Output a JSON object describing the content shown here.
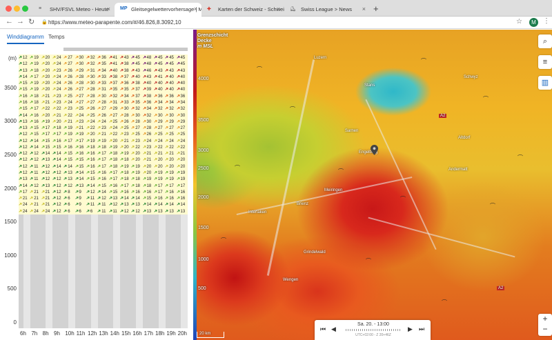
{
  "browser": {
    "tabs": [
      {
        "favicon": "≡",
        "title": "SHV/FSVL Meteo - Heute",
        "active": false
      },
      {
        "favicon": "MP",
        "title": "Gleitsegelwettervorhersage | M",
        "active": true
      },
      {
        "favicon": "✚",
        "title": "Karten der Schweiz - Schweiz",
        "active": false
      },
      {
        "favicon": "⛸",
        "title": "Swiss League > News",
        "active": false
      }
    ],
    "url": "https://www.meteo-parapente.com/#/46.826,8.3092,10",
    "avatar_letter": "M"
  },
  "left_panel": {
    "tabs": [
      "Winddiagramm",
      "Temps"
    ],
    "unit_label": "(m)",
    "y_ticks": [
      "3500",
      "3000",
      "2500",
      "2000",
      "1500",
      "1000",
      "500",
      "0"
    ],
    "hours": [
      "6h",
      "7h",
      "8h",
      "9h",
      "10h",
      "11h",
      "12h",
      "13h",
      "14h",
      "15h",
      "16h",
      "17h",
      "18h",
      "19h",
      "20h"
    ],
    "wind_rows": [
      [
        "12",
        "19",
        "20",
        "24",
        "27",
        "30",
        "32",
        "36",
        "41",
        "43",
        "45",
        "48",
        "45",
        "45",
        "45"
      ],
      [
        "12",
        "19",
        "20",
        "24",
        "27",
        "30",
        "32",
        "35",
        "41",
        "38",
        "45",
        "48",
        "45",
        "45",
        "45"
      ],
      [
        "13",
        "18",
        "20",
        "23",
        "26",
        "29",
        "31",
        "34",
        "40",
        "38",
        "43",
        "46",
        "43",
        "43",
        "43"
      ],
      [
        "14",
        "17",
        "20",
        "24",
        "26",
        "28",
        "30",
        "33",
        "38",
        "37",
        "40",
        "43",
        "41",
        "40",
        "40"
      ],
      [
        "15",
        "19",
        "20",
        "24",
        "26",
        "28",
        "30",
        "33",
        "37",
        "36",
        "38",
        "40",
        "40",
        "40",
        "40"
      ],
      [
        "15",
        "19",
        "20",
        "24",
        "26",
        "27",
        "28",
        "31",
        "35",
        "35",
        "37",
        "39",
        "40",
        "40",
        "40"
      ],
      [
        "16",
        "18",
        "21",
        "23",
        "25",
        "27",
        "28",
        "30",
        "32",
        "34",
        "37",
        "38",
        "36",
        "36",
        "36"
      ],
      [
        "16",
        "18",
        "21",
        "23",
        "24",
        "27",
        "27",
        "28",
        "31",
        "33",
        "35",
        "36",
        "34",
        "34",
        "34"
      ],
      [
        "15",
        "17",
        "22",
        "22",
        "23",
        "25",
        "26",
        "27",
        "29",
        "30",
        "32",
        "34",
        "32",
        "32",
        "32"
      ],
      [
        "14",
        "16",
        "20",
        "21",
        "22",
        "24",
        "25",
        "26",
        "27",
        "28",
        "30",
        "32",
        "30",
        "30",
        "30"
      ],
      [
        "13",
        "16",
        "19",
        "20",
        "21",
        "23",
        "24",
        "24",
        "25",
        "26",
        "28",
        "30",
        "29",
        "29",
        "29"
      ],
      [
        "13",
        "15",
        "17",
        "18",
        "19",
        "21",
        "22",
        "23",
        "24",
        "25",
        "27",
        "28",
        "27",
        "27",
        "27"
      ],
      [
        "12",
        "15",
        "17",
        "17",
        "19",
        "19",
        "20",
        "21",
        "22",
        "23",
        "25",
        "26",
        "25",
        "25",
        "25"
      ],
      [
        "12",
        "14",
        "15",
        "16",
        "17",
        "17",
        "19",
        "19",
        "20",
        "21",
        "23",
        "24",
        "24",
        "24",
        "24"
      ],
      [
        "12",
        "14",
        "15",
        "15",
        "16",
        "16",
        "18",
        "18",
        "19",
        "20",
        "22",
        "23",
        "22",
        "22",
        "22"
      ],
      [
        "12",
        "12",
        "14",
        "14",
        "15",
        "16",
        "16",
        "17",
        "18",
        "19",
        "20",
        "21",
        "21",
        "21",
        "21"
      ],
      [
        "12",
        "12",
        "13",
        "14",
        "15",
        "15",
        "16",
        "17",
        "18",
        "18",
        "20",
        "21",
        "20",
        "20",
        "20"
      ],
      [
        "12",
        "11",
        "12",
        "14",
        "14",
        "15",
        "16",
        "17",
        "18",
        "19",
        "19",
        "20",
        "20",
        "20",
        "20"
      ],
      [
        "12",
        "11",
        "12",
        "12",
        "13",
        "14",
        "15",
        "16",
        "17",
        "18",
        "19",
        "20",
        "19",
        "19",
        "19"
      ],
      [
        "13",
        "11",
        "12",
        "12",
        "13",
        "14",
        "15",
        "16",
        "17",
        "18",
        "18",
        "19",
        "19",
        "19",
        "19"
      ],
      [
        "14",
        "12",
        "13",
        "12",
        "12",
        "13",
        "14",
        "15",
        "16",
        "17",
        "18",
        "18",
        "17",
        "17",
        "17"
      ],
      [
        "17",
        "21",
        "21",
        "12",
        "8",
        "9",
        "12",
        "14",
        "15",
        "16",
        "16",
        "16",
        "17",
        "16",
        "16"
      ],
      [
        "21",
        "21",
        "21",
        "12",
        "6",
        "9",
        "11",
        "12",
        "13",
        "14",
        "14",
        "15",
        "16",
        "16",
        "16"
      ],
      [
        "24",
        "21",
        "21",
        "12",
        "6",
        "9",
        "11",
        "11",
        "12",
        "13",
        "13",
        "14",
        "14",
        "14",
        "14"
      ],
      [
        "24",
        "24",
        "24",
        "12",
        "6",
        "6",
        "6",
        "11",
        "11",
        "12",
        "12",
        "13",
        "13",
        "13",
        "13"
      ]
    ]
  },
  "map": {
    "layer_label_lines": [
      "Grenzschicht",
      "Decke",
      "m MSL"
    ],
    "scale_ticks": [
      "4000",
      "3500",
      "3000",
      "2500",
      "2000",
      "1500",
      "1000",
      "500"
    ],
    "towns": [
      "Luzern",
      "Stans",
      "Engelberg",
      "Sarnen",
      "Schwyz",
      "Altdorf",
      "Meiringen",
      "Andermatt",
      "Interlaken",
      "Brienz",
      "Grindelwald",
      "Wengen"
    ],
    "road_label": "A2",
    "scale_text": "20 km",
    "time_label": "Sa. 20. - 13:00",
    "time_sub": "UTC+02:00 - Z 20+46Z",
    "buttons": {
      "search": "🔍",
      "filters": "☰",
      "chart": "▦",
      "zoom_in": "+",
      "zoom_out": "−"
    }
  }
}
